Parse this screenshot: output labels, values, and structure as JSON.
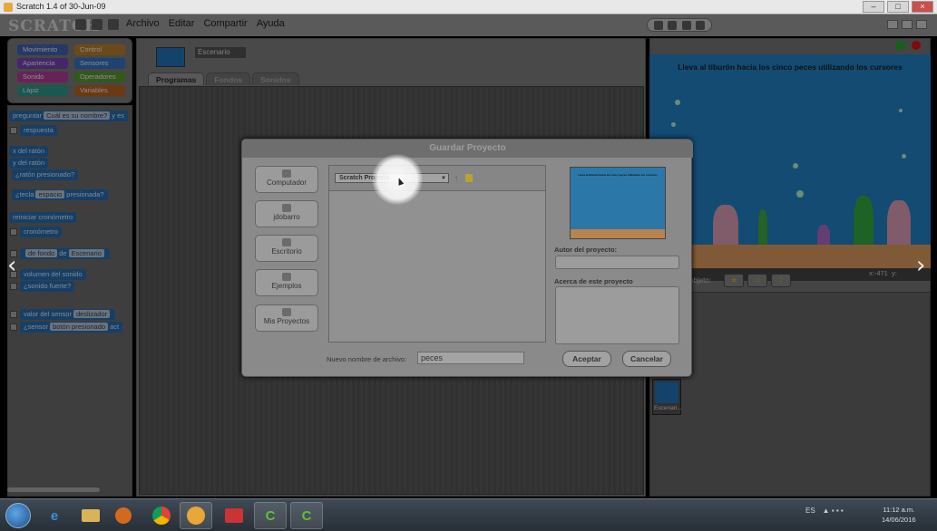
{
  "window": {
    "title": "Scratch 1.4 of 30-Jun-09"
  },
  "logo": "SCRATCH",
  "menu": [
    "Archivo",
    "Editar",
    "Compartir",
    "Ayuda"
  ],
  "categories": [
    {
      "label": "Movimiento",
      "color": "#3b5aa0"
    },
    {
      "label": "Control",
      "color": "#a8742a"
    },
    {
      "label": "Apariencia",
      "color": "#6a3ea3"
    },
    {
      "label": "Sensores",
      "color": "#2f6ab0"
    },
    {
      "label": "Sonido",
      "color": "#a0388e"
    },
    {
      "label": "Operadores",
      "color": "#4f8a2b"
    },
    {
      "label": "Lápiz",
      "color": "#2a8a7e"
    },
    {
      "label": "Variables",
      "color": "#a85a1f"
    }
  ],
  "blocks": {
    "ask": "preguntar",
    "ask_value": "Cuál es su nombre?",
    "ask_suffix": "y es",
    "answer": "respuesta",
    "mouse_x": "x del ratón",
    "mouse_y": "y del ratón",
    "mouse_down": "¿ratón presionado?",
    "key_prefix": "¿tecla",
    "key_value": "espacio",
    "key_suffix": "presionada?",
    "reset_timer": "reiniciar cronómetro",
    "timer": "cronómetro",
    "backdrop_of": "de fondo",
    "of": "de",
    "of_value": "Escenario",
    "loudness": "volumen del sonido",
    "loud": "¿sonido fuerte?",
    "sensor_value": "valor del sensor",
    "sensor_slot": "deslizador",
    "sensor_q": "¿sensor",
    "sensor_q_slot": "botón presionado",
    "sensor_q_suffix": "act"
  },
  "sprite": {
    "name": "Escenario"
  },
  "tabs": [
    "Programas",
    "Fondos",
    "Sonidos"
  ],
  "stage": {
    "instruction": "Lleva al tiburón hacia los cinco peces utilizando los cursores",
    "coords_x_label": "x:",
    "coords_x": "-471",
    "coords_y_label": "y:",
    "sprite_tools_label": "objeto:"
  },
  "sprite_list": {
    "stage_label": "Escenari..."
  },
  "dialog": {
    "title": "Guardar Proyecto",
    "locations": [
      "Computador",
      "jdobarro",
      "Escritorio",
      "Ejemplos",
      "Mis Proyectos"
    ],
    "folder": "Scratch Projects",
    "author_label": "Autor del proyecto:",
    "about_label": "Acerca de este proyecto",
    "filename_label": "Nuevo nombre de archivo:",
    "filename_value": "peces",
    "accept": "Aceptar",
    "cancel": "Cancelar"
  },
  "taskbar": {
    "lang": "ES",
    "time": "11:12 a.m.",
    "date": "14/06/2016"
  },
  "nav": {
    "prev": "‹",
    "next": "›"
  }
}
